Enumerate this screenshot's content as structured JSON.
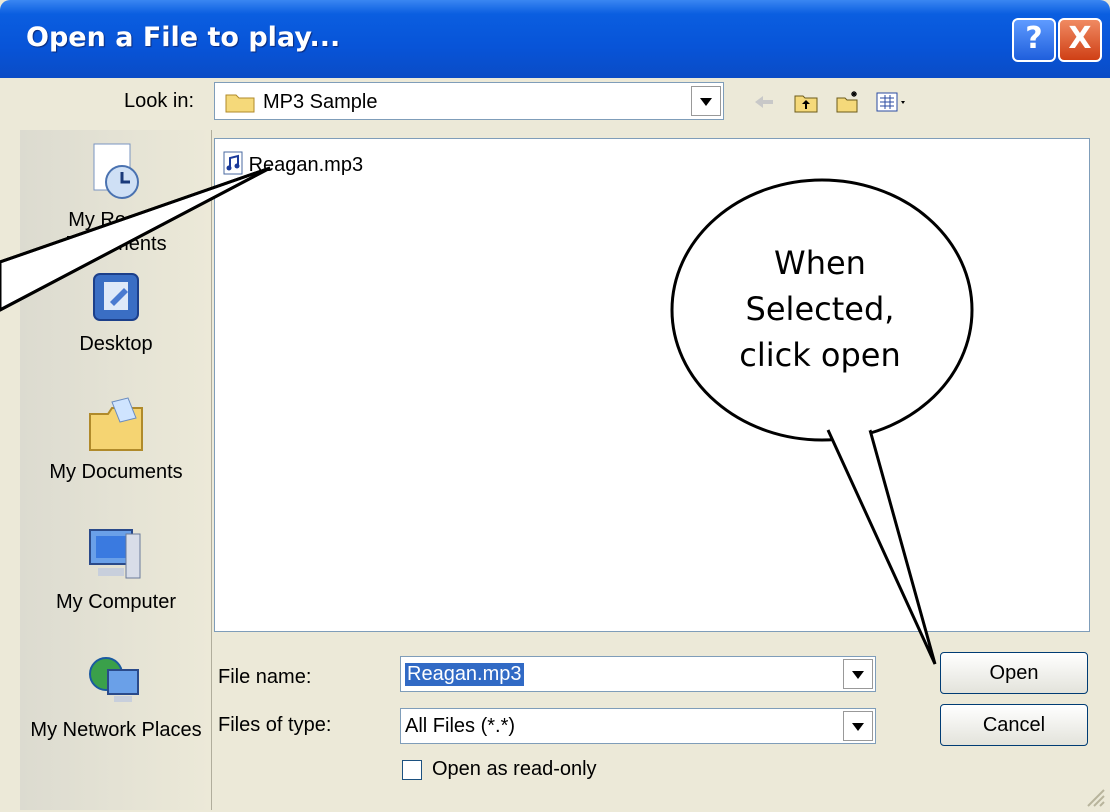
{
  "window": {
    "title": "Open a File to play..."
  },
  "title_buttons": {
    "help": "?",
    "close": "X"
  },
  "lookin": {
    "label": "Look in:",
    "value": "MP3 Sample"
  },
  "toolbar_icons": [
    "back-arrow-icon",
    "up-folder-icon",
    "new-folder-icon",
    "view-menu-icon"
  ],
  "places": [
    {
      "label": "My Recent Documents",
      "icon": "recent-documents-icon"
    },
    {
      "label": "Desktop",
      "icon": "desktop-icon"
    },
    {
      "label": "My Documents",
      "icon": "my-documents-icon"
    },
    {
      "label": "My Computer",
      "icon": "my-computer-icon"
    },
    {
      "label": "My Network Places",
      "icon": "network-places-icon"
    }
  ],
  "files": [
    {
      "name": "Reagan.mp3",
      "icon": "audio-file-icon"
    }
  ],
  "filename": {
    "label": "File name:",
    "value": "Reagan.mp3"
  },
  "filetype": {
    "label": "Files of type:",
    "value": "All Files (*.*)"
  },
  "readonly": {
    "label": "Open as read-only",
    "checked": false
  },
  "buttons": {
    "open": "Open",
    "cancel": "Cancel"
  },
  "callout": {
    "line1": "When",
    "line2": "Selected,",
    "line3": "click open"
  },
  "colors": {
    "titlebar": "#0a5ee0",
    "selection": "#316ac5",
    "dialog_bg": "#ece9d8"
  }
}
